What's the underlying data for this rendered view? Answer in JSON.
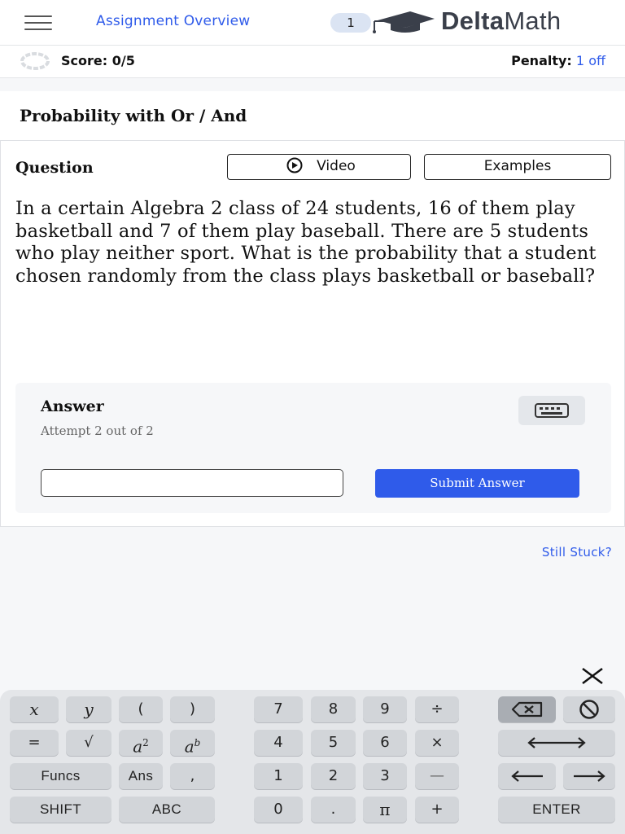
{
  "header": {
    "overview_link": "Assignment Overview",
    "count": "1",
    "logo_bold": "Delta",
    "logo_rest": "Math"
  },
  "scorebar": {
    "score": "Score: 0/5",
    "penalty_label": "Penalty:",
    "penalty_value": "1 off"
  },
  "title": "Probability with Or / And",
  "question": {
    "label": "Question",
    "video_label": "Video",
    "examples_label": "Examples",
    "text": "In a certain Algebra 2 class of 24 students, 16 of them play basketball and 7 of them play baseball. There are 5 students who play neither sport. What is the probability that a student chosen randomly from the class plays basketball or baseball?"
  },
  "answer": {
    "label": "Answer",
    "attempt": "Attempt 2 out of 2",
    "input_value": "",
    "submit_label": "Submit Answer"
  },
  "still_stuck": "Still Stuck?",
  "keyboard": {
    "row1": [
      "x",
      "y",
      "(",
      ")",
      "7",
      "8",
      "9",
      "÷"
    ],
    "row2": [
      "=",
      "√",
      "a",
      "a",
      "4",
      "5",
      "6",
      "×"
    ],
    "row2_sup": [
      "2",
      "b"
    ],
    "row3": [
      "Funcs",
      "Ans",
      ",",
      "1",
      "2",
      "3",
      "—"
    ],
    "row4": [
      "SHIFT",
      "ABC",
      "0",
      ".",
      "π",
      "+",
      "ENTER"
    ],
    "icons": {
      "backspace": "backspace-icon",
      "clear": "clear-icon",
      "left_right": "left-right-arrow-icon",
      "left": "left-arrow-icon",
      "right": "right-arrow-icon"
    }
  },
  "colors": {
    "accent": "#2f5bea",
    "key": "#d2d5d9",
    "key_dark": "#a9adb3"
  }
}
